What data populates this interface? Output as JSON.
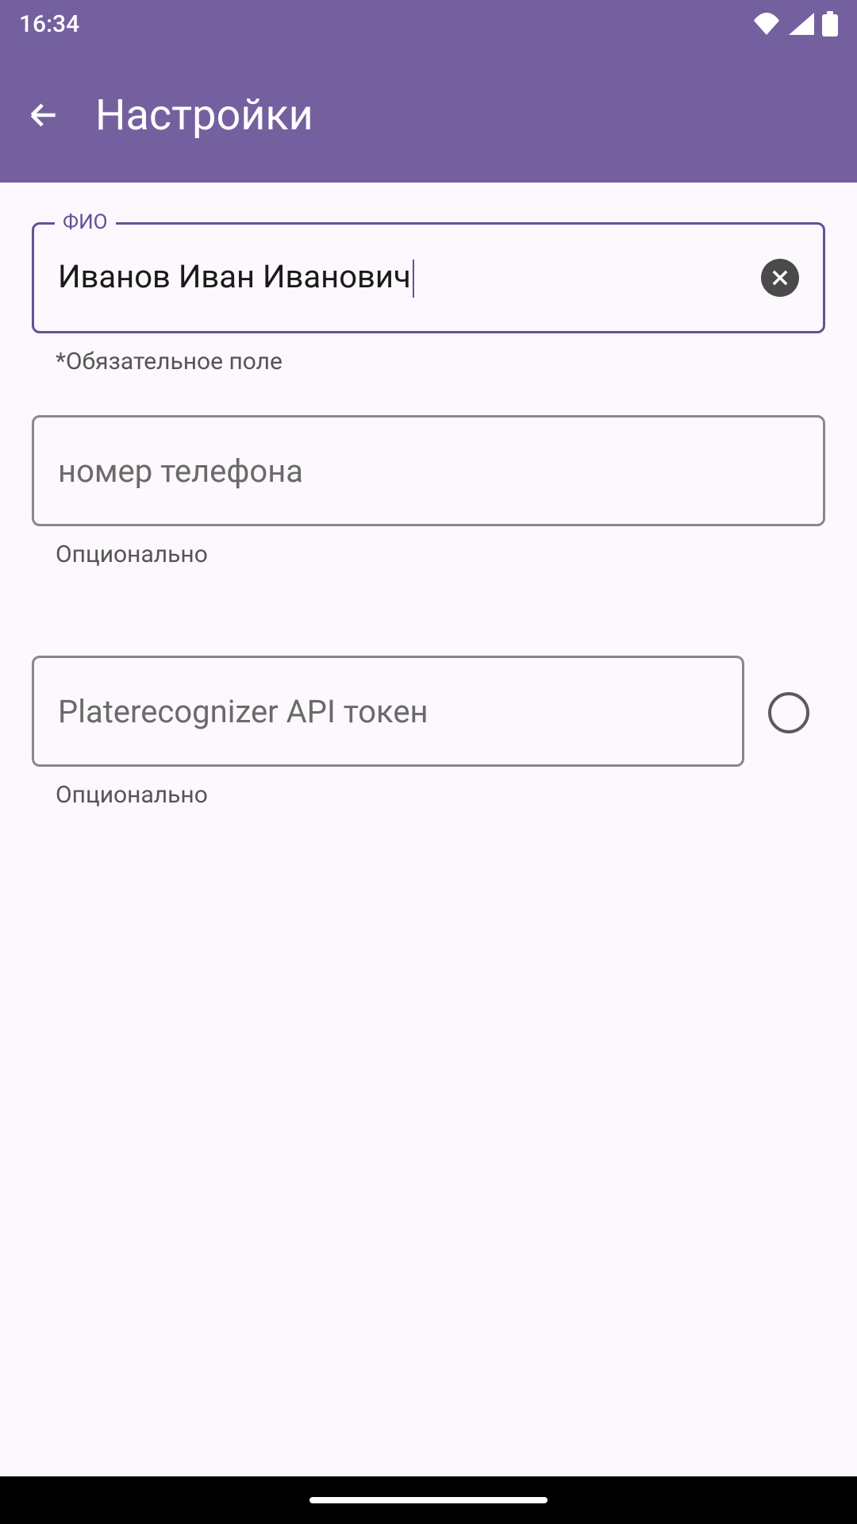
{
  "status": {
    "time": "16:34"
  },
  "appbar": {
    "title": "Настройки"
  },
  "fields": {
    "fio": {
      "label": "ФИО",
      "value": "Иванов Иван Иванович",
      "helper": "*Обязательное поле"
    },
    "phone": {
      "placeholder": "номер телефона",
      "value": "",
      "helper": "Опционально"
    },
    "token": {
      "placeholder": "Platerecognizer API токен",
      "value": "",
      "helper": "Опционально"
    }
  }
}
